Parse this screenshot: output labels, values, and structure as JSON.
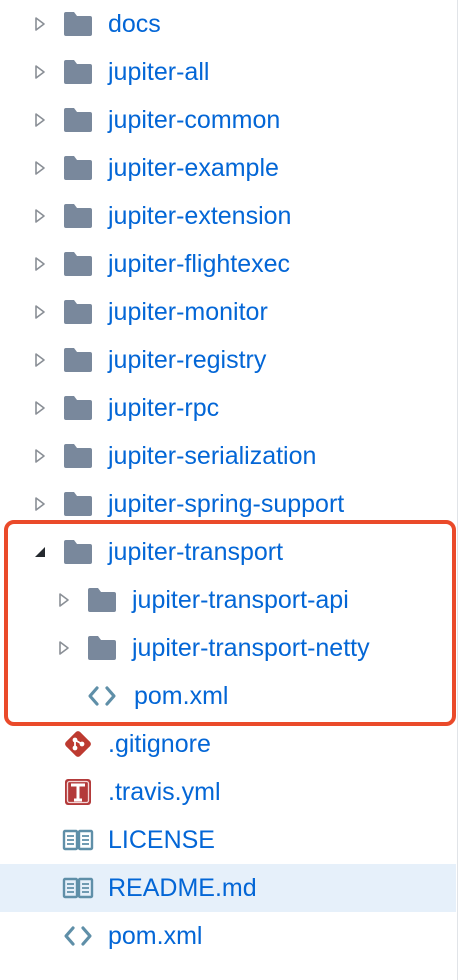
{
  "tree": {
    "items": [
      {
        "label": "docs",
        "type": "folder",
        "expanded": false
      },
      {
        "label": "jupiter-all",
        "type": "folder",
        "expanded": false
      },
      {
        "label": "jupiter-common",
        "type": "folder",
        "expanded": false
      },
      {
        "label": "jupiter-example",
        "type": "folder",
        "expanded": false
      },
      {
        "label": "jupiter-extension",
        "type": "folder",
        "expanded": false
      },
      {
        "label": "jupiter-flightexec",
        "type": "folder",
        "expanded": false
      },
      {
        "label": "jupiter-monitor",
        "type": "folder",
        "expanded": false
      },
      {
        "label": "jupiter-registry",
        "type": "folder",
        "expanded": false
      },
      {
        "label": "jupiter-rpc",
        "type": "folder",
        "expanded": false
      },
      {
        "label": "jupiter-serialization",
        "type": "folder",
        "expanded": false
      },
      {
        "label": "jupiter-spring-support",
        "type": "folder",
        "expanded": false
      },
      {
        "label": "jupiter-transport",
        "type": "folder",
        "expanded": true
      },
      {
        "label": "jupiter-transport-api",
        "type": "folder",
        "expanded": false
      },
      {
        "label": "jupiter-transport-netty",
        "type": "folder",
        "expanded": false
      },
      {
        "label": "pom.xml",
        "type": "code-file"
      },
      {
        "label": ".gitignore",
        "type": "git-file"
      },
      {
        "label": ".travis.yml",
        "type": "travis-file"
      },
      {
        "label": "LICENSE",
        "type": "book-file"
      },
      {
        "label": "README.md",
        "type": "book-file",
        "selected": true
      },
      {
        "label": "pom.xml",
        "type": "code-file"
      }
    ]
  },
  "colors": {
    "link": "#0366d6",
    "folder": "#79889c",
    "highlight": "#ea4a2a",
    "selected_bg": "#e6f0fa"
  }
}
